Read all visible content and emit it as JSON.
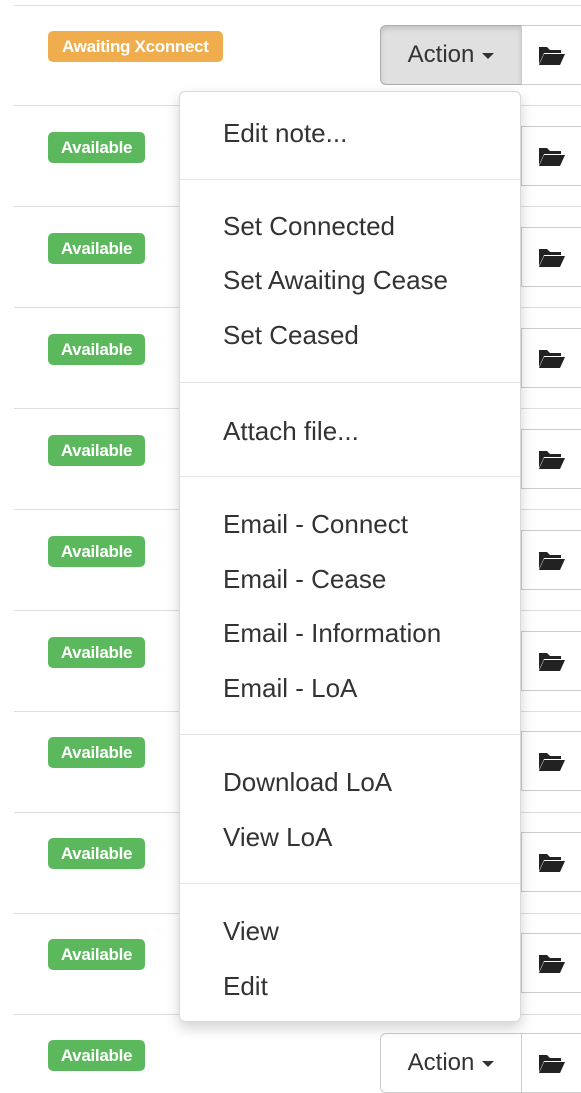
{
  "statuses": {
    "awaiting": "Awaiting Xconnect",
    "available": "Available"
  },
  "action_label": "Action",
  "icons": {
    "caret": "caret-down-icon",
    "folder": "folder-open-icon"
  },
  "colors": {
    "available": "#5cb85c",
    "awaiting": "#f0ad4e"
  },
  "menu": {
    "edit_note": "Edit note...",
    "set_connected": "Set Connected",
    "set_awaiting_cease": "Set Awaiting Cease",
    "set_ceased": "Set Ceased",
    "attach_file": "Attach file...",
    "email_connect": "Email - Connect",
    "email_cease": "Email - Cease",
    "email_information": "Email - Information",
    "email_loa": "Email - LoA",
    "download_loa": "Download LoA",
    "view_loa": "View LoA",
    "view": "View",
    "edit": "Edit"
  }
}
